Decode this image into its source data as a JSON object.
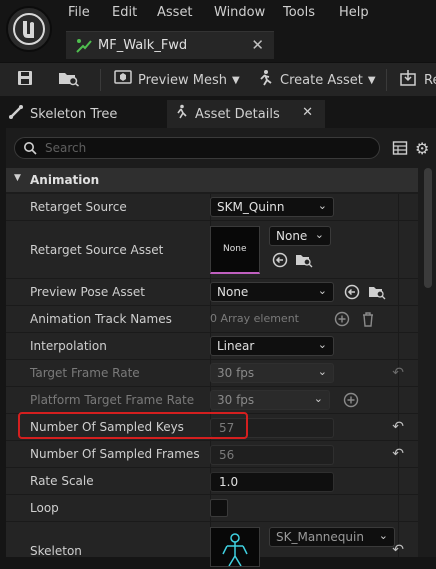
{
  "menu": {
    "items": [
      "File",
      "Edit",
      "Asset",
      "Window",
      "Tools",
      "Help"
    ]
  },
  "document_tab": {
    "title": "MF_Walk_Fwd"
  },
  "toolbar": {
    "preview_mesh_label": "Preview Mesh",
    "create_asset_label": "Create Asset",
    "reimport_label": "Re"
  },
  "panel_tabs": {
    "skeleton_tree": "Skeleton Tree",
    "asset_details": "Asset Details"
  },
  "search": {
    "placeholder": "Search"
  },
  "category": {
    "title": "Animation"
  },
  "properties": {
    "retarget_source": {
      "name": "Retarget Source",
      "value": "SKM_Quinn"
    },
    "retarget_source_asset": {
      "name": "Retarget Source Asset",
      "thumb_text": "None",
      "value": "None"
    },
    "preview_pose_asset": {
      "name": "Preview Pose Asset",
      "value": "None"
    },
    "animation_track_names": {
      "name": "Animation Track Names",
      "value": "0 Array element"
    },
    "interpolation": {
      "name": "Interpolation",
      "value": "Linear"
    },
    "target_frame_rate": {
      "name": "Target Frame Rate",
      "value": "30 fps"
    },
    "platform_target_frame_rate": {
      "name": "Platform Target Frame Rate",
      "value": "30 fps"
    },
    "number_of_sampled_keys": {
      "name": "Number Of Sampled Keys",
      "value": "57"
    },
    "number_of_sampled_frames": {
      "name": "Number Of Sampled Frames",
      "value": "56"
    },
    "rate_scale": {
      "name": "Rate Scale",
      "value": "1.0"
    },
    "loop": {
      "name": "Loop",
      "checked": false
    },
    "skeleton": {
      "name": "Skeleton",
      "value": "SK_Mannequin"
    }
  },
  "colors": {
    "highlight": "#d41f1f",
    "background": "#151515",
    "row": "#242424"
  }
}
